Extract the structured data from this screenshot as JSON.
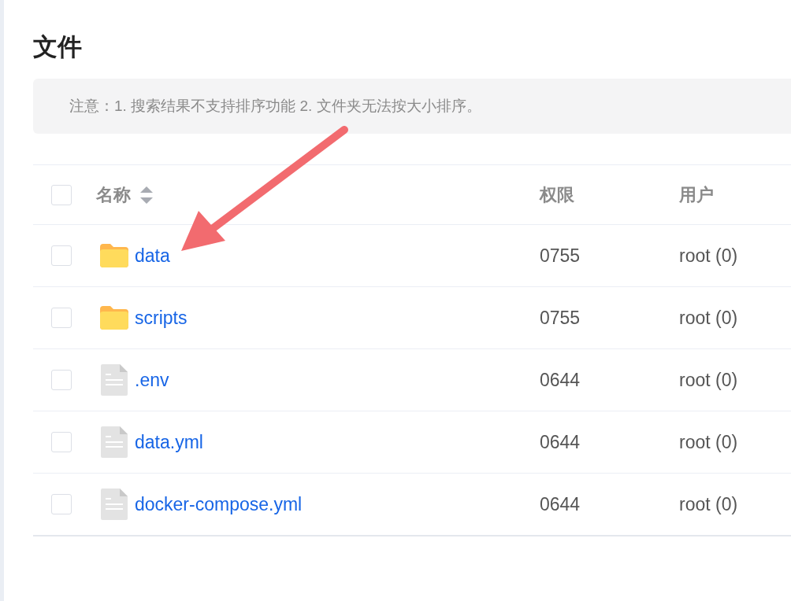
{
  "page": {
    "title": "文件"
  },
  "notice": {
    "text": "注意：1. 搜索结果不支持排序功能 2. 文件夹无法按大小排序。"
  },
  "table": {
    "select_all": {
      "checked": false
    },
    "columns": [
      "名称",
      "权限",
      "用户"
    ],
    "rows": [
      {
        "kind": "folder",
        "name": "data",
        "permission": "0755",
        "user": "root (0)",
        "checked": false
      },
      {
        "kind": "folder",
        "name": "scripts",
        "permission": "0755",
        "user": "root (0)",
        "checked": false
      },
      {
        "kind": "file",
        "name": ".env",
        "permission": "0644",
        "user": "root (0)",
        "checked": false
      },
      {
        "kind": "file",
        "name": "data.yml",
        "permission": "0644",
        "user": "root (0)",
        "checked": false
      },
      {
        "kind": "file",
        "name": "docker-compose.yml",
        "permission": "0644",
        "user": "root (0)",
        "checked": false
      }
    ]
  },
  "annotation": {
    "kind": "arrow"
  }
}
